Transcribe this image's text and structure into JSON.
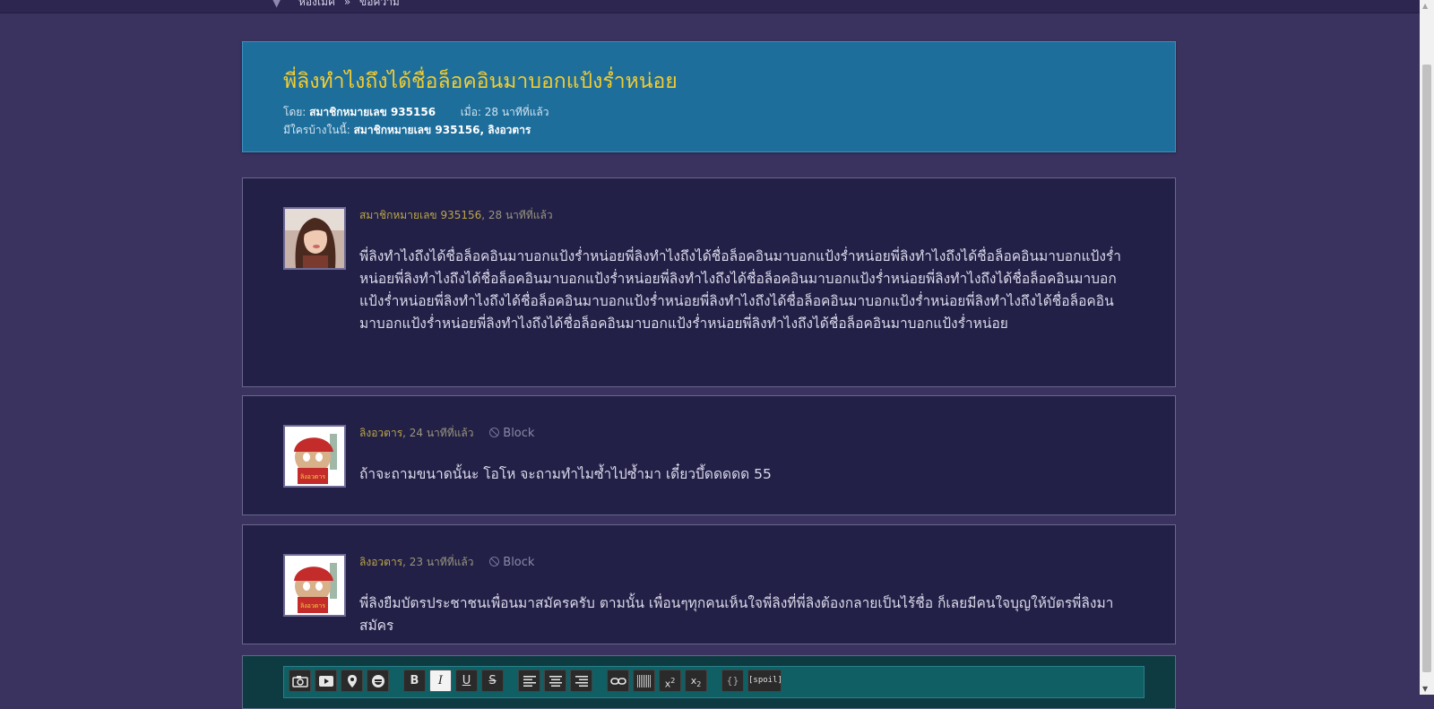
{
  "nav": {
    "breadcrumb_home": "ห้องเม้ค",
    "breadcrumb_sep": "»",
    "breadcrumb_current": "ข้อความ"
  },
  "topic": {
    "title": "พี่ลิงทำไงถึงได้ชื่อล็อคอินมาบอกแป้งร่ำหน่อย",
    "by_label": "โดย:",
    "by_value": "สมาชิกหมายเลข 935156",
    "when_label": "เมื่อ:",
    "when_value": "28 นาทีที่แล้ว",
    "participants_label": "มีใครบ้างในนี้:",
    "participants_value": "สมาชิกหมายเลข 935156, ลิงอวตาร"
  },
  "posts": [
    {
      "author": "สมาชิกหมายเลข 935156",
      "time": ", 28 นาทีที่แล้ว",
      "body": "พี่ลิงทำไงถึงได้ชื่อล็อคอินมาบอกแป้งร่ำหน่อยพี่ลิงทำไงถึงได้ชื่อล็อคอินมาบอกแป้งร่ำหน่อยพี่ลิงทำไงถึงได้ชื่อล็อคอินมาบอกแป้งร่ำหน่อยพี่ลิงทำไงถึงได้ชื่อล็อคอินมาบอกแป้งร่ำหน่อยพี่ลิงทำไงถึงได้ชื่อล็อคอินมาบอกแป้งร่ำหน่อยพี่ลิงทำไงถึงได้ชื่อล็อคอินมาบอกแป้งร่ำหน่อยพี่ลิงทำไงถึงได้ชื่อล็อคอินมาบอกแป้งร่ำหน่อยพี่ลิงทำไงถึงได้ชื่อล็อคอินมาบอกแป้งร่ำหน่อยพี่ลิงทำไงถึงได้ชื่อล็อคอินมาบอกแป้งร่ำหน่อยพี่ลิงทำไงถึงได้ชื่อล็อคอินมาบอกแป้งร่ำหน่อยพี่ลิงทำไงถึงได้ชื่อล็อคอินมาบอกแป้งร่ำหน่อย"
    },
    {
      "author": "ลิงอวตาร",
      "time": ", 24 นาทีที่แล้ว",
      "block": "Block",
      "body": "ถ้าจะถามขนาดนั้นะ โอโห จะถามทำไมซ้ำไปซ้ำมา เดี๋ยวบึ้ดดดดด 55"
    },
    {
      "author": "ลิงอวตาร",
      "time": ", 23 นาทีที่แล้ว",
      "block": "Block",
      "body": "พี่ลิงยืมบัตรประชาชนเพื่อนมาสมัครครับ ตามนั้น เพื่อนๆทุกคนเห็นใจพี่ลิงที่พี่ลิงต้องกลายเป็นไร้ชื่อ ก็เลยมีคนใจบุญให้บัตรพี่ลิงมาสมัคร"
    }
  ],
  "editor": {
    "buttons": [
      {
        "name": "camera-icon"
      },
      {
        "name": "video-icon"
      },
      {
        "name": "map-pin-icon"
      },
      {
        "name": "emoji-icon"
      },
      {
        "name": "bold-button",
        "label": "B"
      },
      {
        "name": "italic-button",
        "label": "I"
      },
      {
        "name": "underline-button",
        "label": "U"
      },
      {
        "name": "strike-button",
        "label": "S"
      },
      {
        "name": "align-left-icon"
      },
      {
        "name": "align-center-icon"
      },
      {
        "name": "align-right-icon"
      },
      {
        "name": "link-icon"
      },
      {
        "name": "barcode-icon"
      },
      {
        "name": "superscript-button",
        "label": "x2"
      },
      {
        "name": "subscript-button",
        "label": "x2"
      },
      {
        "name": "code-button",
        "label": "{}"
      },
      {
        "name": "spoil-button",
        "label": "[spoil]"
      }
    ]
  },
  "colors": {
    "background": "#3b335f",
    "header": "#1e6e9c",
    "title": "#f3cc2e",
    "author": "#bba646",
    "post_bg": "#222046"
  }
}
